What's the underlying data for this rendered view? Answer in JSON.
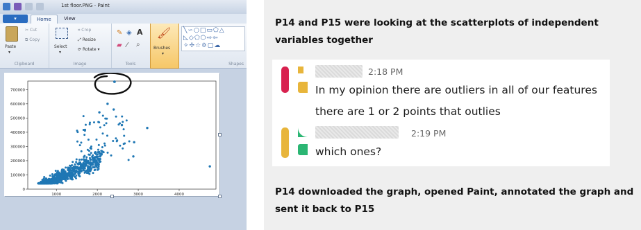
{
  "paint": {
    "window_title": "1st floor.PNG - Paint",
    "file_button": "",
    "tabs": [
      "Home",
      "View"
    ],
    "ribbon": {
      "clipboard": {
        "paste": "Paste",
        "cut": "Cut",
        "copy": "Copy",
        "group": "Clipboard"
      },
      "image": {
        "select": "Select",
        "crop": "Crop",
        "resize": "Resize",
        "rotate": "Rotate",
        "group": "Image"
      },
      "tools": {
        "group": "Tools"
      },
      "brushes": "Brushes",
      "shapes": {
        "group": "Shapes"
      }
    }
  },
  "chart_data": {
    "type": "scatter",
    "title": "",
    "xlabel": "",
    "ylabel": "",
    "xlim": [
      300,
      4900
    ],
    "ylim": [
      0,
      760000
    ],
    "xticks": [
      1000,
      2000,
      3000,
      4000
    ],
    "yticks": [
      0,
      100000,
      200000,
      300000,
      400000,
      500000,
      600000,
      700000
    ],
    "xtick_labels": [
      "1000",
      "2000",
      "3000",
      "4000"
    ],
    "ytick_labels": [
      "0",
      "100000",
      "200000",
      "300000",
      "400000",
      "500000",
      "600000",
      "700000"
    ],
    "point_color": "#1f77b4",
    "highlighted_point": [
      2420,
      755000
    ],
    "outlier_points": [
      [
        3220,
        430000
      ],
      [
        4750,
        160000
      ],
      [
        2880,
        230000
      ],
      [
        2900,
        330000
      ],
      [
        2600,
        450000
      ],
      [
        2050,
        540000
      ],
      [
        2250,
        600000
      ],
      [
        2400,
        560000
      ]
    ],
    "cluster": {
      "x_center": 1350,
      "y_center": 180000,
      "note": "dense cloud of points"
    }
  },
  "annotation": {
    "circle_color": "#111111"
  },
  "panel": {
    "heading_top": "P14 and P15 were looking at the scatterplots of independent variables together",
    "heading_bottom": "P14 downloaded the graph, opened Paint, annotated the graph and sent it back to P15"
  },
  "chat": {
    "messages": [
      {
        "time": "2:18 PM",
        "lines": [
          "In my opinion there are outliers in all of our features",
          "there are 1 or 2 points that outlies"
        ],
        "avatar_colors": [
          "#d8214f",
          "#e8b53b",
          "#e8b53b"
        ]
      },
      {
        "time": "2:19 PM",
        "lines": [
          "which ones?"
        ],
        "avatar_colors": [
          "#e8b53b",
          "#2bb673",
          "#2bb673"
        ]
      }
    ]
  }
}
